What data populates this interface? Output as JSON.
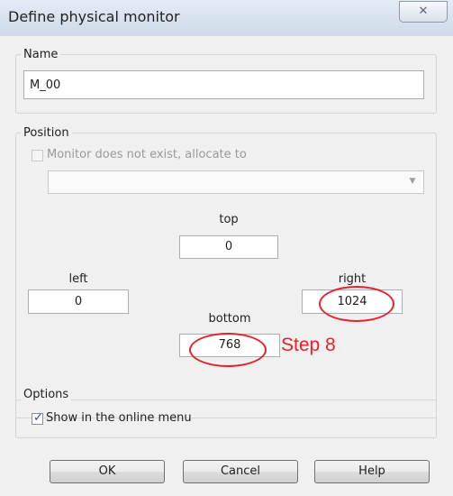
{
  "window": {
    "title": "Define physical monitor",
    "close_glyph": "✕"
  },
  "name_group": {
    "legend": "Name",
    "value": "M_00"
  },
  "position_group": {
    "legend": "Position",
    "allocate_checkbox": {
      "label": "Monitor does not exist, allocate to",
      "checked": false,
      "enabled": false
    },
    "allocate_combo": {
      "value": "",
      "enabled": false
    },
    "top": {
      "label": "top",
      "value": "0"
    },
    "left": {
      "label": "left",
      "value": "0"
    },
    "right": {
      "label": "right",
      "value": "1024"
    },
    "bottom": {
      "label": "bottom",
      "value": "768"
    }
  },
  "options_group": {
    "legend": "Options",
    "show_online_menu": {
      "label": "Show in the online menu",
      "checked": true,
      "check_glyph": "✓"
    }
  },
  "buttons": {
    "ok": "OK",
    "cancel": "Cancel",
    "help": "Help"
  },
  "annotation": {
    "text": "Step 8",
    "color": "#e3222a"
  }
}
